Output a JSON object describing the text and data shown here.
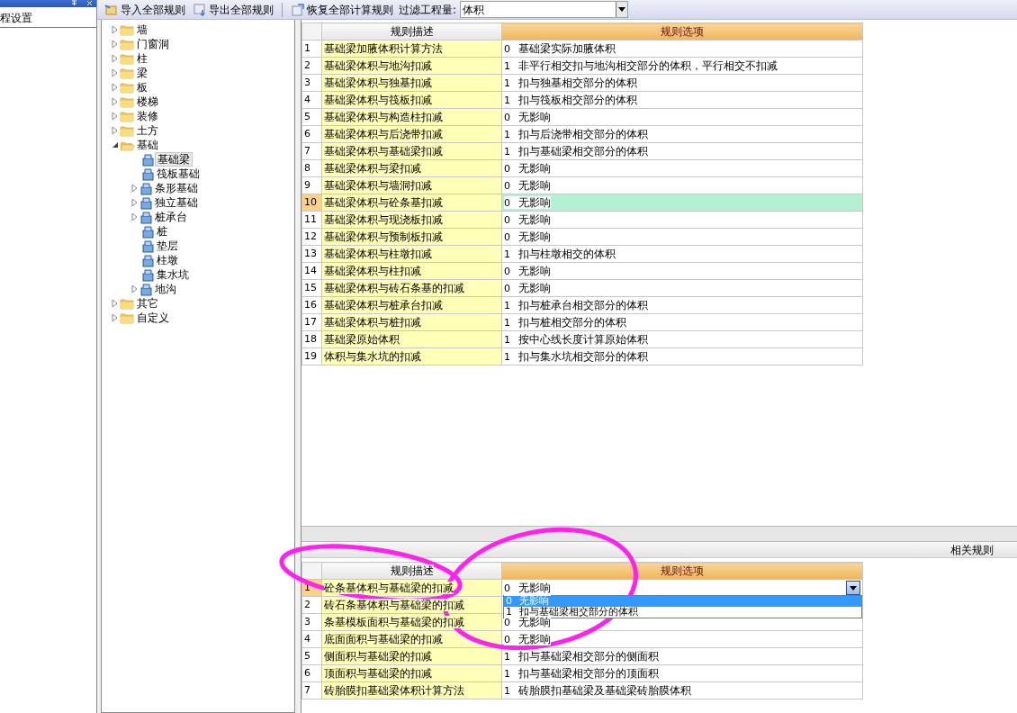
{
  "left_panel": {
    "items": [
      {
        "label": "程设置"
      }
    ]
  },
  "toolbar": {
    "buttons": [
      {
        "label": "导入全部规则",
        "kind": "import"
      },
      {
        "label": "导出全部规则",
        "kind": "export"
      },
      {
        "label": "恢复全部计算规则",
        "kind": "restore"
      }
    ],
    "filter_label": "过滤工程量:",
    "filter_value": "体积"
  },
  "tree": [
    {
      "label": "墙",
      "kind": "folder",
      "expanded": false
    },
    {
      "label": "门窗洞",
      "kind": "folder",
      "expanded": false
    },
    {
      "label": "柱",
      "kind": "folder",
      "expanded": false
    },
    {
      "label": "梁",
      "kind": "folder",
      "expanded": false
    },
    {
      "label": "板",
      "kind": "folder",
      "expanded": false
    },
    {
      "label": "楼梯",
      "kind": "folder",
      "expanded": false
    },
    {
      "label": "装修",
      "kind": "folder",
      "expanded": false
    },
    {
      "label": "土方",
      "kind": "folder",
      "expanded": false
    },
    {
      "label": "基础",
      "kind": "folder",
      "expanded": true,
      "children": [
        {
          "label": "基础梁",
          "kind": "component",
          "selected": true
        },
        {
          "label": "筏板基础",
          "kind": "component",
          "selected": false
        },
        {
          "label": "条形基础",
          "kind": "component",
          "selected": false,
          "expanded": false
        },
        {
          "label": "独立基础",
          "kind": "component",
          "selected": false,
          "expanded": false
        },
        {
          "label": "桩承台",
          "kind": "component",
          "selected": false,
          "expanded": false
        },
        {
          "label": "桩",
          "kind": "component",
          "selected": false
        },
        {
          "label": "垫层",
          "kind": "component",
          "selected": false
        },
        {
          "label": "柱墩",
          "kind": "component",
          "selected": false
        },
        {
          "label": "集水坑",
          "kind": "component",
          "selected": false
        },
        {
          "label": "地沟",
          "kind": "component",
          "selected": false,
          "expanded": false
        }
      ]
    },
    {
      "label": "其它",
      "kind": "folder",
      "expanded": false
    },
    {
      "label": "自定义",
      "kind": "folder",
      "expanded": false
    }
  ],
  "rules_table": {
    "columns": [
      "规则描述",
      "规则选项"
    ],
    "rows": [
      {
        "number": "1",
        "description": "基础梁加腋体积计算方法",
        "code": "0",
        "option": "基础梁实际加腋体积",
        "selected": false
      },
      {
        "number": "2",
        "description": "基础梁体积与地沟扣减",
        "code": "1",
        "option": "非平行相交扣与地沟相交部分的体积，平行相交不扣减",
        "selected": false
      },
      {
        "number": "3",
        "description": "基础梁体积与独基扣减",
        "code": "1",
        "option": "扣与独基相交部分的体积",
        "selected": false
      },
      {
        "number": "4",
        "description": "基础梁体积与筏板扣减",
        "code": "1",
        "option": "扣与筏板相交部分的体积",
        "selected": false
      },
      {
        "number": "5",
        "description": "基础梁体积与构造柱扣减",
        "code": "0",
        "option": "无影响",
        "selected": false
      },
      {
        "number": "6",
        "description": "基础梁体积与后浇带扣减",
        "code": "1",
        "option": "扣与后浇带相交部分的体积",
        "selected": false
      },
      {
        "number": "7",
        "description": "基础梁体积与基础梁扣减",
        "code": "1",
        "option": "扣与基础梁相交部分的体积",
        "selected": false
      },
      {
        "number": "8",
        "description": "基础梁体积与梁扣减",
        "code": "0",
        "option": "无影响",
        "selected": false
      },
      {
        "number": "9",
        "description": "基础梁体积与墙洞扣减",
        "code": "0",
        "option": "无影响",
        "selected": false
      },
      {
        "number": "10",
        "description": "基础梁体积与砼条基扣减",
        "code": "0",
        "option": "无影响",
        "selected": true
      },
      {
        "number": "11",
        "description": "基础梁体积与现浇板扣减",
        "code": "0",
        "option": "无影响",
        "selected": false
      },
      {
        "number": "12",
        "description": "基础梁体积与预制板扣减",
        "code": "0",
        "option": "无影响",
        "selected": false
      },
      {
        "number": "13",
        "description": "基础梁体积与柱墩扣减",
        "code": "1",
        "option": "扣与柱墩相交的体积",
        "selected": false
      },
      {
        "number": "14",
        "description": "基础梁体积与柱扣减",
        "code": "0",
        "option": "无影响",
        "selected": false
      },
      {
        "number": "15",
        "description": "基础梁体积与砖石条基的扣减",
        "code": "0",
        "option": "无影响",
        "selected": false
      },
      {
        "number": "16",
        "description": "基础梁体积与桩承台扣减",
        "code": "1",
        "option": "扣与桩承台相交部分的体积",
        "selected": false
      },
      {
        "number": "17",
        "description": "基础梁体积与桩扣减",
        "code": "1",
        "option": "扣与桩相交部分的体积",
        "selected": false
      },
      {
        "number": "18",
        "description": "基础梁原始体积",
        "code": "1",
        "option": "按中心线长度计算原始体积",
        "selected": false
      },
      {
        "number": "19",
        "description": "体积与集水坑的扣减",
        "code": "1",
        "option": "扣与集水坑相交部分的体积",
        "selected": false
      }
    ]
  },
  "related_rules": {
    "title": "相关规则",
    "columns": [
      "规则描述",
      "规则选项"
    ],
    "rows": [
      {
        "number": "1",
        "description": "砼条基体积与基础梁的扣减",
        "code": "0",
        "option": "无影响",
        "selected": true,
        "dropdown": [
          {
            "code": "0",
            "label": "无影响",
            "selected": true
          },
          {
            "code": "1",
            "label": "扣与基础梁相交部分的体积",
            "selected": false
          }
        ]
      },
      {
        "number": "2",
        "description": "砖石条基体积与基础梁的扣减",
        "selected": false
      },
      {
        "number": "3",
        "description": "条基模板面积与基础梁的扣减",
        "code": "0",
        "option": "无影响",
        "selected": false
      },
      {
        "number": "4",
        "description": "底面面积与基础梁的扣减",
        "code": "0",
        "option": "无影响",
        "selected": false
      },
      {
        "number": "5",
        "description": "侧面积与基础梁的扣减",
        "code": "1",
        "option": "扣与基础梁相交部分的侧面积",
        "selected": false
      },
      {
        "number": "6",
        "description": "顶面积与基础梁的扣减",
        "code": "1",
        "option": "扣与基础梁相交部分的顶面积",
        "selected": false
      },
      {
        "number": "7",
        "description": "砖胎膜扣基础梁体积计算方法",
        "code": "1",
        "option": "砖胎膜扣基础梁及基础梁砖胎膜体积",
        "selected": false
      }
    ]
  },
  "annotations": [
    {
      "kind": "ellipse",
      "color": "#ff22ee"
    },
    {
      "kind": "ellipse",
      "color": "#ff22ee"
    }
  ]
}
